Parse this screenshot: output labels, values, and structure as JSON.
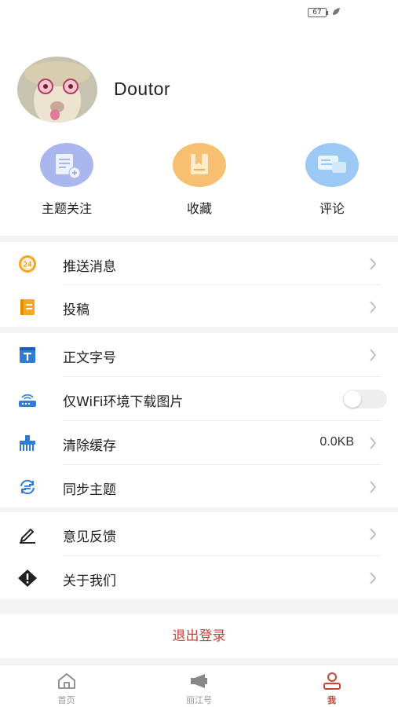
{
  "status_bar": {
    "battery": "67"
  },
  "profile": {
    "username": "Doutor"
  },
  "quick_actions": [
    {
      "label": "主题关注",
      "icon": "doc-plus-icon",
      "color": "#a9b7ee"
    },
    {
      "label": "收藏",
      "icon": "bookmark-icon",
      "color": "#f7c070"
    },
    {
      "label": "评论",
      "icon": "comment-icon",
      "color": "#9cc9f4"
    }
  ],
  "menu_group1": [
    {
      "label": "推送消息",
      "icon": "badge-24-icon"
    },
    {
      "label": "投稿",
      "icon": "submit-doc-icon"
    }
  ],
  "menu_group2": [
    {
      "label": "正文字号",
      "icon": "font-size-icon"
    },
    {
      "label": "仅WiFi环境下载图片",
      "icon": "wifi-router-icon",
      "toggle": false
    },
    {
      "label": "清除缓存",
      "icon": "broom-icon",
      "value": "0.0KB"
    },
    {
      "label": "同步主题",
      "icon": "sync-icon"
    }
  ],
  "menu_group3": [
    {
      "label": "意见反馈",
      "icon": "pencil-icon"
    },
    {
      "label": "关于我们",
      "icon": "info-diamond-icon"
    }
  ],
  "logout_label": "退出登录",
  "tabs": [
    {
      "label": "首页",
      "icon": "home-icon",
      "active": false
    },
    {
      "label": "丽江号",
      "icon": "megaphone-icon",
      "active": false
    },
    {
      "label": "我",
      "icon": "person-icon",
      "active": true
    }
  ],
  "colors": {
    "accent": "#c9433a",
    "page_bg": "#f4f4f4"
  }
}
